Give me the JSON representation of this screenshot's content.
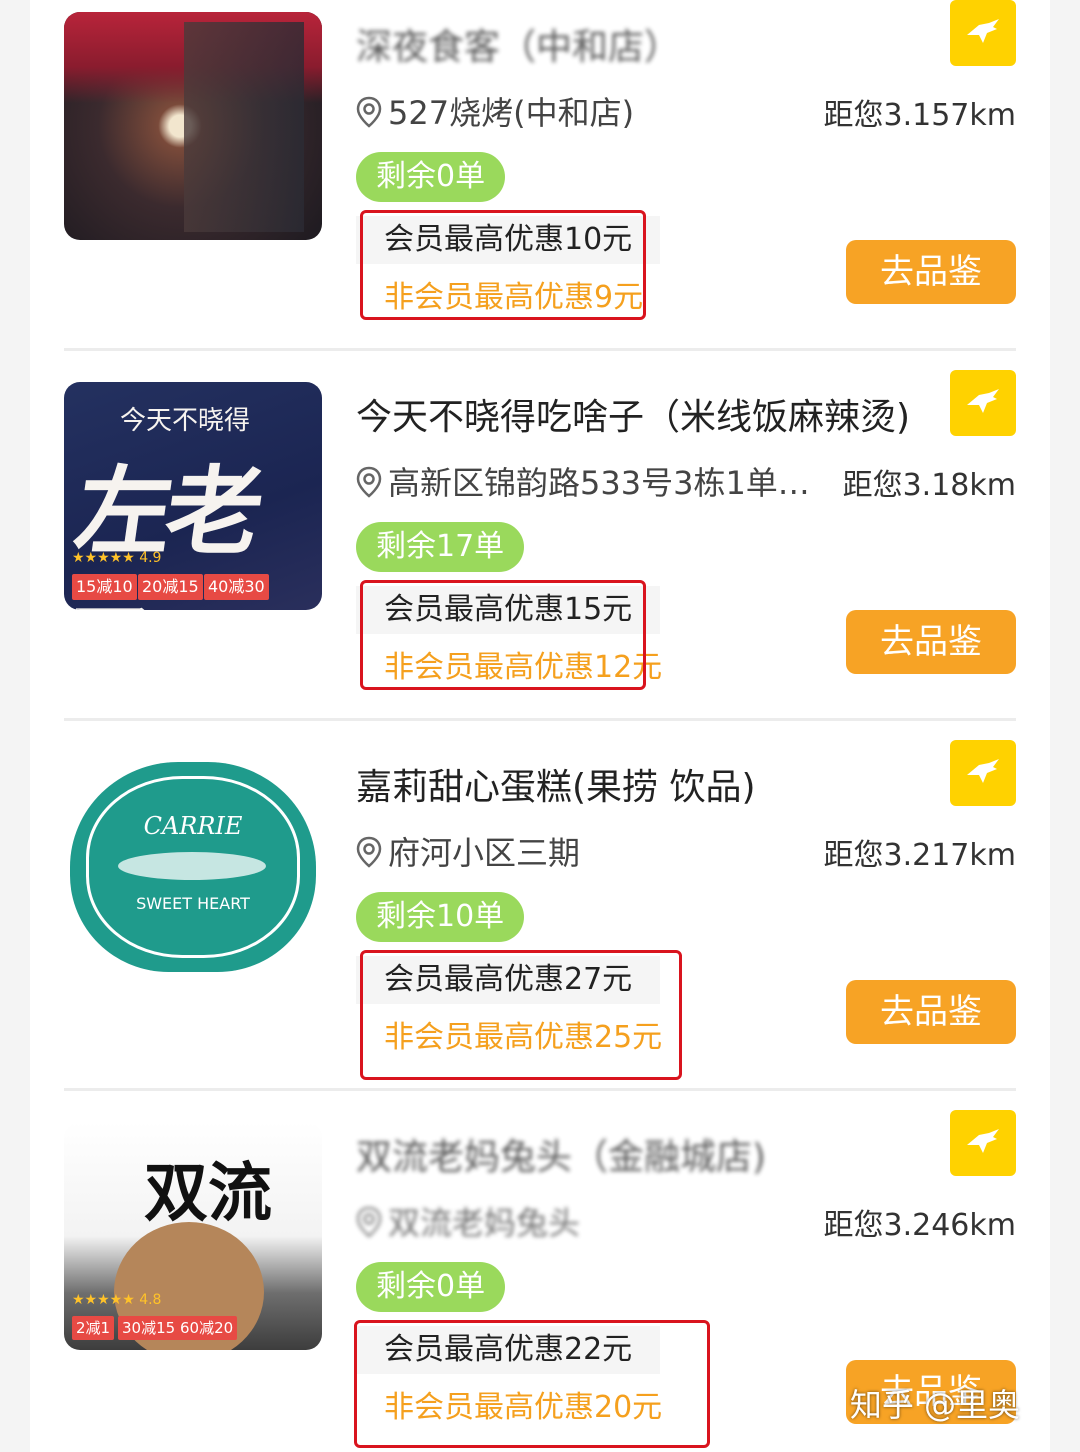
{
  "colors": {
    "accent": "#f7a325",
    "remain_badge": "#9ad95c",
    "fav_icon_bg": "#ffd200",
    "nonmember_text": "#f5a01e",
    "highlight_frame": "#d9141e"
  },
  "stores": [
    {
      "name": "深夜食客（中和店）",
      "address": "527烧烤(中和店)",
      "distance": "距您3.157km",
      "remain": "剩余0单",
      "member_offer": "会员最高优惠10元",
      "nonmember_offer": "非会员最高优惠9元",
      "button": "去品鉴",
      "blurred": true
    },
    {
      "name": "今天不晓得吃啥子（米线饭麻辣烫)",
      "address": "高新区锦韵路533号3栋1单…",
      "distance": "距您3.18km",
      "remain": "剩余17单",
      "member_offer": "会员最高优惠15元",
      "nonmember_offer": "非会员最高优惠12元",
      "button": "去品鉴",
      "thumb": {
        "logo_text": "左老子",
        "header_text": "今天不晓得",
        "rating": "★★★★★ 4.9",
        "promos": [
          "15减10",
          "20减15",
          "40减30"
        ]
      }
    },
    {
      "name": "嘉莉甜心蛋糕(果捞 饮品)",
      "address": "府河小区三期",
      "distance": "距您3.217km",
      "remain": "剩余10单",
      "member_offer": "会员最高优惠27元",
      "nonmember_offer": "非会员最高优惠25元",
      "button": "去品鉴",
      "thumb": {
        "line1": "CARRIE",
        "line2": "SWEET HEART"
      }
    },
    {
      "name": "双流老妈兔头（金融城店)",
      "address": "双流老妈兔头",
      "distance": "距您3.246km",
      "remain": "剩余0单",
      "member_offer": "会员最高优惠22元",
      "nonmember_offer": "非会员最高优惠20元",
      "button": "去品鉴",
      "blurred": true,
      "thumb": {
        "logo_text": "双流",
        "rating": "★★★★★ 4.8",
        "promos": [
          "2减1",
          "30减15",
          "60减20"
        ]
      }
    }
  ],
  "watermark": "知乎 @里奥"
}
